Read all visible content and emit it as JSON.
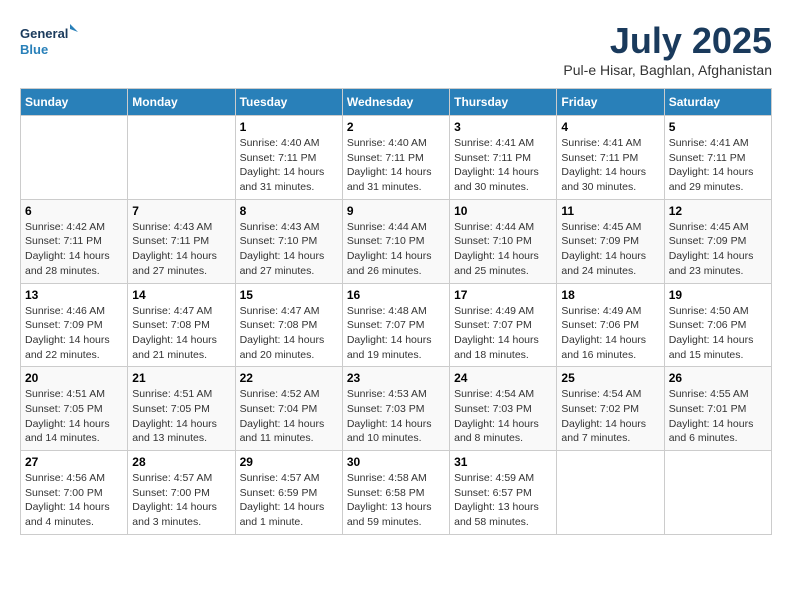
{
  "header": {
    "logo_line1": "General",
    "logo_line2": "Blue",
    "title": "July 2025",
    "subtitle": "Pul-e Hisar, Baghlan, Afghanistan"
  },
  "days_of_week": [
    "Sunday",
    "Monday",
    "Tuesday",
    "Wednesday",
    "Thursday",
    "Friday",
    "Saturday"
  ],
  "weeks": [
    [
      {
        "day": "",
        "sunrise": "",
        "sunset": "",
        "daylight": ""
      },
      {
        "day": "",
        "sunrise": "",
        "sunset": "",
        "daylight": ""
      },
      {
        "day": "1",
        "sunrise": "Sunrise: 4:40 AM",
        "sunset": "Sunset: 7:11 PM",
        "daylight": "Daylight: 14 hours and 31 minutes."
      },
      {
        "day": "2",
        "sunrise": "Sunrise: 4:40 AM",
        "sunset": "Sunset: 7:11 PM",
        "daylight": "Daylight: 14 hours and 31 minutes."
      },
      {
        "day": "3",
        "sunrise": "Sunrise: 4:41 AM",
        "sunset": "Sunset: 7:11 PM",
        "daylight": "Daylight: 14 hours and 30 minutes."
      },
      {
        "day": "4",
        "sunrise": "Sunrise: 4:41 AM",
        "sunset": "Sunset: 7:11 PM",
        "daylight": "Daylight: 14 hours and 30 minutes."
      },
      {
        "day": "5",
        "sunrise": "Sunrise: 4:41 AM",
        "sunset": "Sunset: 7:11 PM",
        "daylight": "Daylight: 14 hours and 29 minutes."
      }
    ],
    [
      {
        "day": "6",
        "sunrise": "Sunrise: 4:42 AM",
        "sunset": "Sunset: 7:11 PM",
        "daylight": "Daylight: 14 hours and 28 minutes."
      },
      {
        "day": "7",
        "sunrise": "Sunrise: 4:43 AM",
        "sunset": "Sunset: 7:11 PM",
        "daylight": "Daylight: 14 hours and 27 minutes."
      },
      {
        "day": "8",
        "sunrise": "Sunrise: 4:43 AM",
        "sunset": "Sunset: 7:10 PM",
        "daylight": "Daylight: 14 hours and 27 minutes."
      },
      {
        "day": "9",
        "sunrise": "Sunrise: 4:44 AM",
        "sunset": "Sunset: 7:10 PM",
        "daylight": "Daylight: 14 hours and 26 minutes."
      },
      {
        "day": "10",
        "sunrise": "Sunrise: 4:44 AM",
        "sunset": "Sunset: 7:10 PM",
        "daylight": "Daylight: 14 hours and 25 minutes."
      },
      {
        "day": "11",
        "sunrise": "Sunrise: 4:45 AM",
        "sunset": "Sunset: 7:09 PM",
        "daylight": "Daylight: 14 hours and 24 minutes."
      },
      {
        "day": "12",
        "sunrise": "Sunrise: 4:45 AM",
        "sunset": "Sunset: 7:09 PM",
        "daylight": "Daylight: 14 hours and 23 minutes."
      }
    ],
    [
      {
        "day": "13",
        "sunrise": "Sunrise: 4:46 AM",
        "sunset": "Sunset: 7:09 PM",
        "daylight": "Daylight: 14 hours and 22 minutes."
      },
      {
        "day": "14",
        "sunrise": "Sunrise: 4:47 AM",
        "sunset": "Sunset: 7:08 PM",
        "daylight": "Daylight: 14 hours and 21 minutes."
      },
      {
        "day": "15",
        "sunrise": "Sunrise: 4:47 AM",
        "sunset": "Sunset: 7:08 PM",
        "daylight": "Daylight: 14 hours and 20 minutes."
      },
      {
        "day": "16",
        "sunrise": "Sunrise: 4:48 AM",
        "sunset": "Sunset: 7:07 PM",
        "daylight": "Daylight: 14 hours and 19 minutes."
      },
      {
        "day": "17",
        "sunrise": "Sunrise: 4:49 AM",
        "sunset": "Sunset: 7:07 PM",
        "daylight": "Daylight: 14 hours and 18 minutes."
      },
      {
        "day": "18",
        "sunrise": "Sunrise: 4:49 AM",
        "sunset": "Sunset: 7:06 PM",
        "daylight": "Daylight: 14 hours and 16 minutes."
      },
      {
        "day": "19",
        "sunrise": "Sunrise: 4:50 AM",
        "sunset": "Sunset: 7:06 PM",
        "daylight": "Daylight: 14 hours and 15 minutes."
      }
    ],
    [
      {
        "day": "20",
        "sunrise": "Sunrise: 4:51 AM",
        "sunset": "Sunset: 7:05 PM",
        "daylight": "Daylight: 14 hours and 14 minutes."
      },
      {
        "day": "21",
        "sunrise": "Sunrise: 4:51 AM",
        "sunset": "Sunset: 7:05 PM",
        "daylight": "Daylight: 14 hours and 13 minutes."
      },
      {
        "day": "22",
        "sunrise": "Sunrise: 4:52 AM",
        "sunset": "Sunset: 7:04 PM",
        "daylight": "Daylight: 14 hours and 11 minutes."
      },
      {
        "day": "23",
        "sunrise": "Sunrise: 4:53 AM",
        "sunset": "Sunset: 7:03 PM",
        "daylight": "Daylight: 14 hours and 10 minutes."
      },
      {
        "day": "24",
        "sunrise": "Sunrise: 4:54 AM",
        "sunset": "Sunset: 7:03 PM",
        "daylight": "Daylight: 14 hours and 8 minutes."
      },
      {
        "day": "25",
        "sunrise": "Sunrise: 4:54 AM",
        "sunset": "Sunset: 7:02 PM",
        "daylight": "Daylight: 14 hours and 7 minutes."
      },
      {
        "day": "26",
        "sunrise": "Sunrise: 4:55 AM",
        "sunset": "Sunset: 7:01 PM",
        "daylight": "Daylight: 14 hours and 6 minutes."
      }
    ],
    [
      {
        "day": "27",
        "sunrise": "Sunrise: 4:56 AM",
        "sunset": "Sunset: 7:00 PM",
        "daylight": "Daylight: 14 hours and 4 minutes."
      },
      {
        "day": "28",
        "sunrise": "Sunrise: 4:57 AM",
        "sunset": "Sunset: 7:00 PM",
        "daylight": "Daylight: 14 hours and 3 minutes."
      },
      {
        "day": "29",
        "sunrise": "Sunrise: 4:57 AM",
        "sunset": "Sunset: 6:59 PM",
        "daylight": "Daylight: 14 hours and 1 minute."
      },
      {
        "day": "30",
        "sunrise": "Sunrise: 4:58 AM",
        "sunset": "Sunset: 6:58 PM",
        "daylight": "Daylight: 13 hours and 59 minutes."
      },
      {
        "day": "31",
        "sunrise": "Sunrise: 4:59 AM",
        "sunset": "Sunset: 6:57 PM",
        "daylight": "Daylight: 13 hours and 58 minutes."
      },
      {
        "day": "",
        "sunrise": "",
        "sunset": "",
        "daylight": ""
      },
      {
        "day": "",
        "sunrise": "",
        "sunset": "",
        "daylight": ""
      }
    ]
  ]
}
